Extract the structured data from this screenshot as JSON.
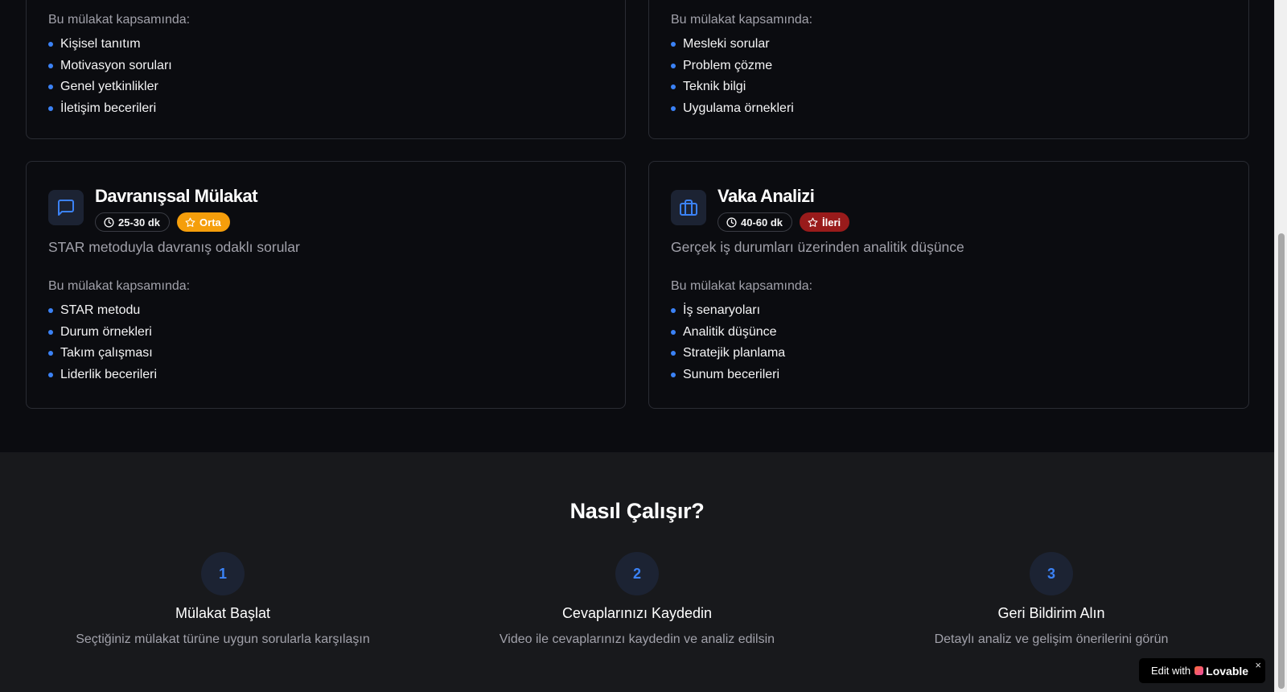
{
  "cards_top": [
    {
      "cover_title": "Bu mülakat kapsamında:",
      "items": [
        "Kişisel tanıtım",
        "Motivasyon soruları",
        "Genel yetkinlikler",
        "İletişim becerileri"
      ]
    },
    {
      "cover_title": "Bu mülakat kapsamında:",
      "items": [
        "Mesleki sorular",
        "Problem çözme",
        "Teknik bilgi",
        "Uygulama örnekleri"
      ]
    }
  ],
  "cards_bottom": [
    {
      "icon": "message-square-icon",
      "title": "Davranışsal Mülakat",
      "duration": "25-30 dk",
      "level": "Orta",
      "level_color": "#f59e0b",
      "description": "STAR metoduyla davranış odaklı sorular",
      "cover_title": "Bu mülakat kapsamında:",
      "items": [
        "STAR metodu",
        "Durum örnekleri",
        "Takım çalışması",
        "Liderlik becerileri"
      ]
    },
    {
      "icon": "briefcase-icon",
      "title": "Vaka Analizi",
      "duration": "40-60 dk",
      "level": "İleri",
      "level_color": "#991b1b",
      "description": "Gerçek iş durumları üzerinden analitik düşünce",
      "cover_title": "Bu mülakat kapsamında:",
      "items": [
        "İş senaryoları",
        "Analitik düşünce",
        "Stratejik planlama",
        "Sunum becerileri"
      ]
    }
  ],
  "how_it_works": {
    "title": "Nasıl Çalışır?",
    "steps": [
      {
        "number": "1",
        "title": "Mülakat Başlat",
        "description": "Seçtiğiniz mülakat türüne uygun sorularla karşılaşın"
      },
      {
        "number": "2",
        "title": "Cevaplarınızı Kaydedin",
        "description": "Video ile cevaplarınızı kaydedin ve analiz edilsin"
      },
      {
        "number": "3",
        "title": "Geri Bildirim Alın",
        "description": "Detaylı analiz ve gelişim önerilerini görün"
      }
    ]
  },
  "lovable_badge": {
    "prefix": "Edit with",
    "brand": "Lovable",
    "close": "×"
  },
  "colors": {
    "accent": "#3b82f6",
    "background": "#0b0c10",
    "section_bg": "#18191c",
    "orta": "#f59e0b",
    "ileri": "#991b1b"
  }
}
